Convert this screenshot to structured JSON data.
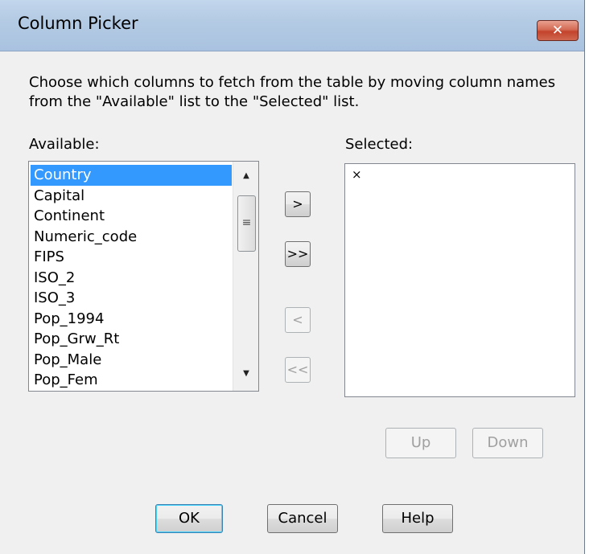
{
  "window": {
    "title": "Column Picker",
    "close_label": "✕",
    "description": "Choose which columns to fetch from the table by moving column names from the \"Available\" list to the \"Selected\" list."
  },
  "available": {
    "label": "Available:",
    "items": [
      "Country",
      "Capital",
      "Continent",
      "Numeric_code",
      "FIPS",
      "ISO_2",
      "ISO_3",
      "Pop_1994",
      "Pop_Grw_Rt",
      "Pop_Male",
      "Pop_Fem"
    ],
    "selected_item": "Country",
    "scroll_up_label": "▲",
    "scroll_down_label": "▼",
    "scroll_thumb_grip": "≡"
  },
  "selected_list": {
    "label": "Selected:",
    "items": [
      "×"
    ]
  },
  "move_buttons": {
    "add": ">",
    "add_all": ">>",
    "remove": "<",
    "remove_all": "<<"
  },
  "order_buttons": {
    "up": "Up",
    "down": "Down"
  },
  "footer": {
    "ok": "OK",
    "cancel": "Cancel",
    "help": "Help"
  }
}
